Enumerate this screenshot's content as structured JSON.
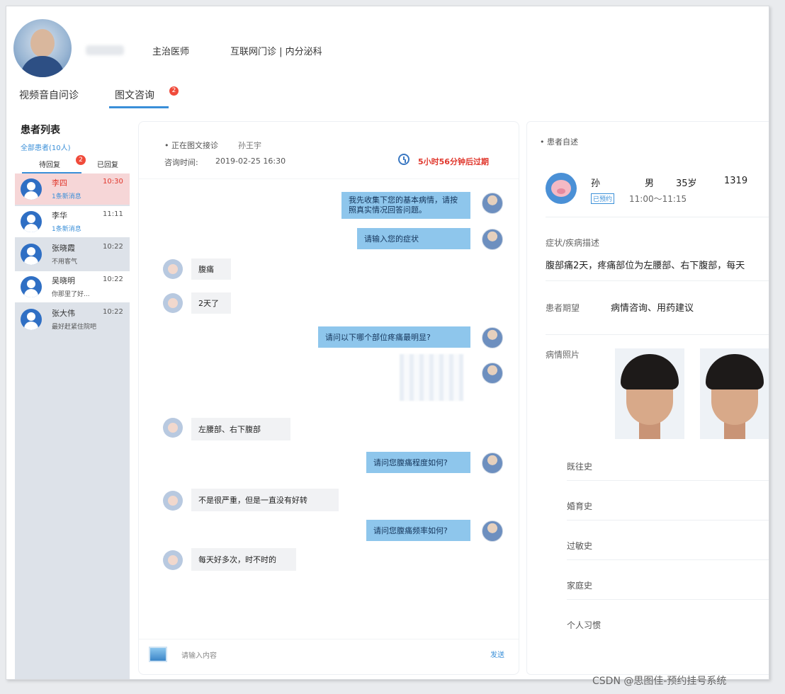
{
  "header": {
    "doctor_title": "主治医师",
    "department": "互联网门诊 | 内分泌科"
  },
  "tabs": [
    {
      "label": "视频音自问诊"
    },
    {
      "label": "图文咨询",
      "badge": "2"
    }
  ],
  "patient_list": {
    "title": "患者列表",
    "subtitle": "全部患者(10人)",
    "tab_left": "待回复",
    "tab_left_badge": "2",
    "tab_right": "已回复",
    "items": [
      {
        "name": "李四",
        "time": "10:30",
        "msg": "1条新消息"
      },
      {
        "name": "李华",
        "time": "11:11",
        "msg": "1条新消息"
      },
      {
        "name": "张晓霞",
        "time": "10:22",
        "msg": "不用客气"
      },
      {
        "name": "吴晓明",
        "time": "10:22",
        "msg": "你那里了好..."
      },
      {
        "name": "张大伟",
        "time": "10:22",
        "msg": "最好赶紧住院吧"
      }
    ]
  },
  "chat": {
    "status": "• 正在图文接诊",
    "patient": "孙王宇",
    "time_label": "咨询时间:",
    "time_value": "2019-02-25 16:30",
    "countdown": "5小时56分钟后过期",
    "messages": [
      {
        "side": "out",
        "text": "我先收集下您的基本病情，请按照真实情况回答问题。"
      },
      {
        "side": "out",
        "text": "请输入您的症状"
      },
      {
        "side": "in",
        "text": "腹痛"
      },
      {
        "side": "in",
        "text": "2天了"
      },
      {
        "side": "out",
        "text": "请问以下哪个部位疼痛最明显?"
      },
      {
        "side": "in",
        "text": "左腰部、右下腹部"
      },
      {
        "side": "out",
        "text": "请问您腹痛程度如何?"
      },
      {
        "side": "in",
        "text": "不是很严重，但是一直没有好转"
      },
      {
        "side": "out",
        "text": "请问您腹痛频率如何?"
      },
      {
        "side": "in",
        "text": "每天好多次，时不时的"
      }
    ],
    "input_placeholder": "请输入内容",
    "send_label": "发送"
  },
  "detail": {
    "header": "• 患者自述",
    "name": "孙",
    "sex": "男",
    "age": "35岁",
    "phone": "1319",
    "tag": "已预约",
    "slot": "11:00～11:15",
    "symptom_label": "症状/疾病描述",
    "symptom_value": "腹部痛2天，疼痛部位为左腰部、右下腹部，每天",
    "expect_label": "患者期望",
    "expect_value": "病情咨询、用药建议",
    "photo_label": "病情照片",
    "history": [
      "既往史",
      "婚育史",
      "过敏史",
      "家庭史",
      "个人习惯"
    ]
  },
  "watermark": "CSDN @思图佳-预约挂号系统"
}
